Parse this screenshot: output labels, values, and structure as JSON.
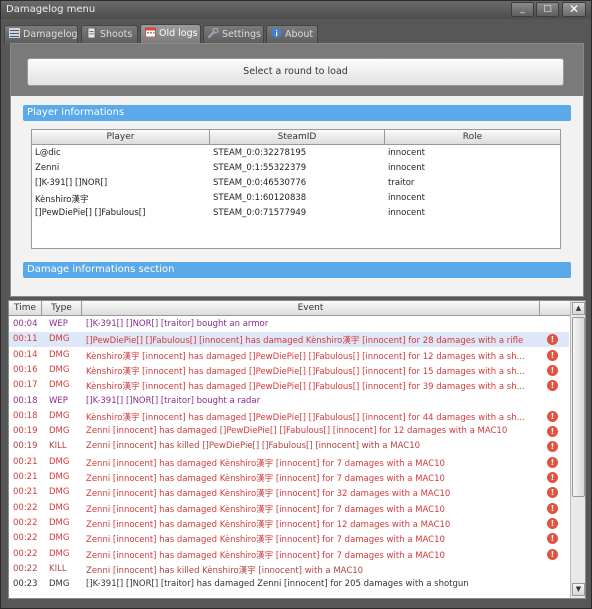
{
  "window": {
    "title": "Damagelog menu",
    "buttons": [
      "_",
      "□",
      "✕"
    ]
  },
  "tabs": [
    {
      "label": "Damagelog",
      "icon": "list-icon"
    },
    {
      "label": "Shoots",
      "icon": "document-icon"
    },
    {
      "label": "Old logs",
      "icon": "calendar-icon",
      "active": true
    },
    {
      "label": "Settings",
      "icon": "wrench-icon"
    },
    {
      "label": "About",
      "icon": "info-icon"
    }
  ],
  "select_round_label": "Select a round to load",
  "player_section": {
    "title": "Player informations",
    "columns": [
      "Player",
      "SteamID",
      "Role"
    ],
    "rows": [
      [
        "L@dic",
        "STEAM_0:0:32278195",
        "innocent"
      ],
      [
        "Zenni",
        "STEAM_0:1:55322379",
        "innocent"
      ],
      [
        "[]K-391[] []NOR[]",
        "STEAM_0:0:46530776",
        "traitor"
      ],
      [
        "Kènshiro漢宇",
        "STEAM_0:1:60120838",
        "innocent"
      ],
      [
        "[]PewDiePie[] []Fabulous[]",
        "STEAM_0:0:71577949",
        "innocent"
      ]
    ]
  },
  "damage_section": {
    "title": "Damage informations section"
  },
  "log": {
    "columns": [
      "Time",
      "Type",
      "Event"
    ],
    "colors": {
      "dmg": "#d43a3a",
      "wep": "#8a2b94",
      "kill": "#b04444",
      "default": "#333333"
    },
    "rows": [
      {
        "time": "00:04",
        "type": "WEP",
        "event": "[]K-391[] []NOR[] [traitor] bought an armor",
        "kind": "wep",
        "warn": false
      },
      {
        "time": "00:11",
        "type": "DMG",
        "event": "[]PewDiePie[] []Fabulous[] [innocent] has damaged Kènshiro漢宇 [innocent] for 28 damages with a rifle",
        "kind": "dmg",
        "warn": true,
        "selected": true
      },
      {
        "time": "00:14",
        "type": "DMG",
        "event": "Kènshiro漢宇 [innocent] has damaged []PewDiePie[] []Fabulous[] [innocent] for 12 damages with a sh...",
        "kind": "dmg",
        "warn": true
      },
      {
        "time": "00:16",
        "type": "DMG",
        "event": "Kènshiro漢宇 [innocent] has damaged []PewDiePie[] []Fabulous[] [innocent] for 15 damages with a sh...",
        "kind": "dmg",
        "warn": true
      },
      {
        "time": "00:17",
        "type": "DMG",
        "event": "Kènshiro漢宇 [innocent] has damaged []PewDiePie[] []Fabulous[] [innocent] for 39 damages with a sh...",
        "kind": "dmg",
        "warn": true
      },
      {
        "time": "00:18",
        "type": "WEP",
        "event": "[]K-391[] []NOR[] [traitor] bought a radar",
        "kind": "wep",
        "warn": false
      },
      {
        "time": "00:18",
        "type": "DMG",
        "event": "Kènshiro漢宇 [innocent] has damaged []PewDiePie[] []Fabulous[] [innocent] for 44 damages with a sh...",
        "kind": "dmg",
        "warn": true
      },
      {
        "time": "00:19",
        "type": "DMG",
        "event": "Zenni [innocent] has damaged []PewDiePie[] []Fabulous[] [innocent] for 12 damages with a MAC10",
        "kind": "dmg",
        "warn": true
      },
      {
        "time": "00:19",
        "type": "KILL",
        "event": "Zenni [innocent] has killed []PewDiePie[] []Fabulous[] [innocent] with a MAC10",
        "kind": "kill",
        "warn": true
      },
      {
        "time": "00:21",
        "type": "DMG",
        "event": "Zenni [innocent] has damaged Kènshiro漢宇 [innocent] for 7 damages with a MAC10",
        "kind": "dmg",
        "warn": true
      },
      {
        "time": "00:21",
        "type": "DMG",
        "event": "Zenni [innocent] has damaged Kènshiro漢宇 [innocent] for 7 damages with a MAC10",
        "kind": "dmg",
        "warn": true
      },
      {
        "time": "00:21",
        "type": "DMG",
        "event": "Zenni [innocent] has damaged Kènshiro漢宇 [innocent] for 32 damages with a MAC10",
        "kind": "dmg",
        "warn": true
      },
      {
        "time": "00:22",
        "type": "DMG",
        "event": "Zenni [innocent] has damaged Kènshiro漢宇 [innocent] for 7 damages with a MAC10",
        "kind": "dmg",
        "warn": true
      },
      {
        "time": "00:22",
        "type": "DMG",
        "event": "Zenni [innocent] has damaged Kènshiro漢宇 [innocent] for 12 damages with a MAC10",
        "kind": "dmg",
        "warn": true
      },
      {
        "time": "00:22",
        "type": "DMG",
        "event": "Zenni [innocent] has damaged Kènshiro漢宇 [innocent] for 7 damages with a MAC10",
        "kind": "dmg",
        "warn": true
      },
      {
        "time": "00:22",
        "type": "DMG",
        "event": "Zenni [innocent] has damaged Kènshiro漢宇 [innocent] for 7 damages with a MAC10",
        "kind": "dmg",
        "warn": true
      },
      {
        "time": "00:22",
        "type": "KILL",
        "event": "Zenni [innocent] has killed Kènshiro漢宇 [innocent] with a MAC10",
        "kind": "kill",
        "warn": false
      },
      {
        "time": "00:23",
        "type": "DMG",
        "event": "[]K-391[] []NOR[] [traitor] has damaged Zenni [innocent] for 205 damages with a shotgun",
        "kind": "default",
        "warn": false
      }
    ]
  }
}
